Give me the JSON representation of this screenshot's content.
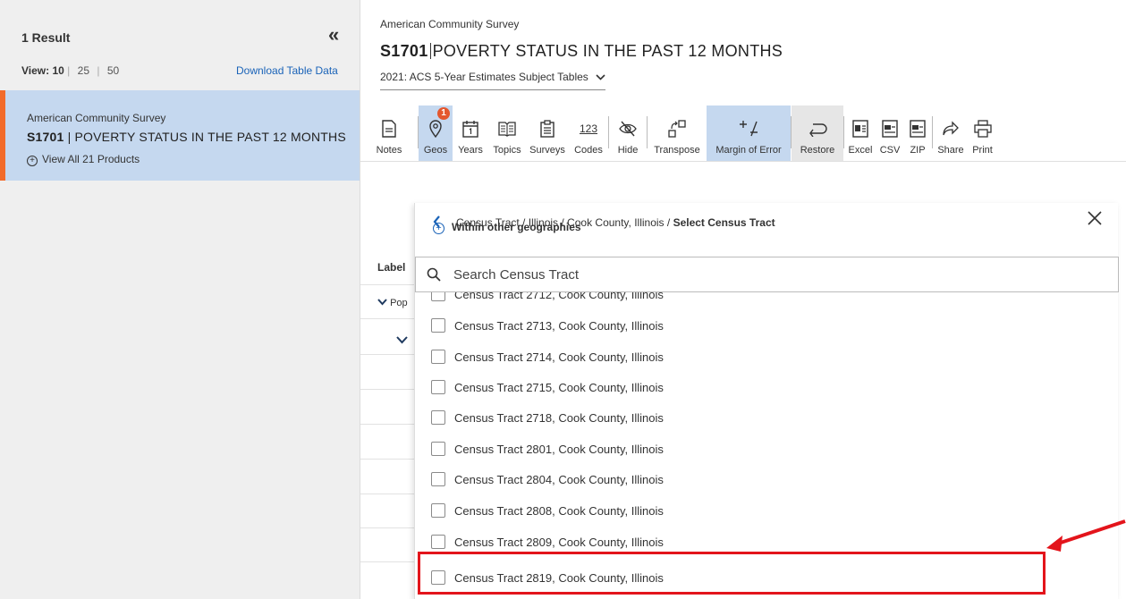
{
  "left_panel": {
    "result_count": "1 Result",
    "collapse_icon": "«",
    "view_label": "View:",
    "view_options": [
      "10",
      "25",
      "50"
    ],
    "download_label": "Download Table Data",
    "result_card": {
      "survey": "American Community Survey",
      "table_id": "S1701",
      "table_title": "POVERTY STATUS IN THE PAST 12 MONTHS",
      "products_label": "View All 21 Products"
    }
  },
  "header": {
    "survey": "American Community Survey",
    "table_id": "S1701",
    "table_title": "POVERTY STATUS IN THE PAST 12 MONTHS",
    "vintage": "2021: ACS 5-Year Estimates Subject Tables"
  },
  "toolbar": {
    "notes": "Notes",
    "geos": "Geos",
    "geos_badge": "1",
    "years": "Years",
    "topics": "Topics",
    "surveys": "Surveys",
    "codes": "Codes",
    "codes_icon_text": "123",
    "hide": "Hide",
    "transpose": "Transpose",
    "margin_of_error": "Margin of Error",
    "restore": "Restore",
    "excel": "Excel",
    "csv": "CSV",
    "zip": "ZIP",
    "share": "Share",
    "print": "Print"
  },
  "table": {
    "label_header": "Label",
    "row1": "Pop"
  },
  "geo_popup": {
    "crumb_path": "Census Tract / Illinois / Cook County, Illinois / ",
    "crumb_current": "Select Census Tract",
    "within_label": "Within other geographies",
    "search_placeholder": "Search Census Tract",
    "items": [
      "Census Tract 2712, Cook County, Illinois",
      "Census Tract 2713, Cook County, Illinois",
      "Census Tract 2714, Cook County, Illinois",
      "Census Tract 2715, Cook County, Illinois",
      "Census Tract 2718, Cook County, Illinois",
      "Census Tract 2801, Cook County, Illinois",
      "Census Tract 2804, Cook County, Illinois",
      "Census Tract 2808, Cook County, Illinois",
      "Census Tract 2809, Cook County, Illinois",
      "Census Tract 2819, Cook County, Illinois"
    ]
  },
  "colors": {
    "accent_blue": "#1a63b8",
    "active_bg": "#c5d8ef",
    "card_border": "#f26b2b",
    "annotation_red": "#e3141b"
  }
}
